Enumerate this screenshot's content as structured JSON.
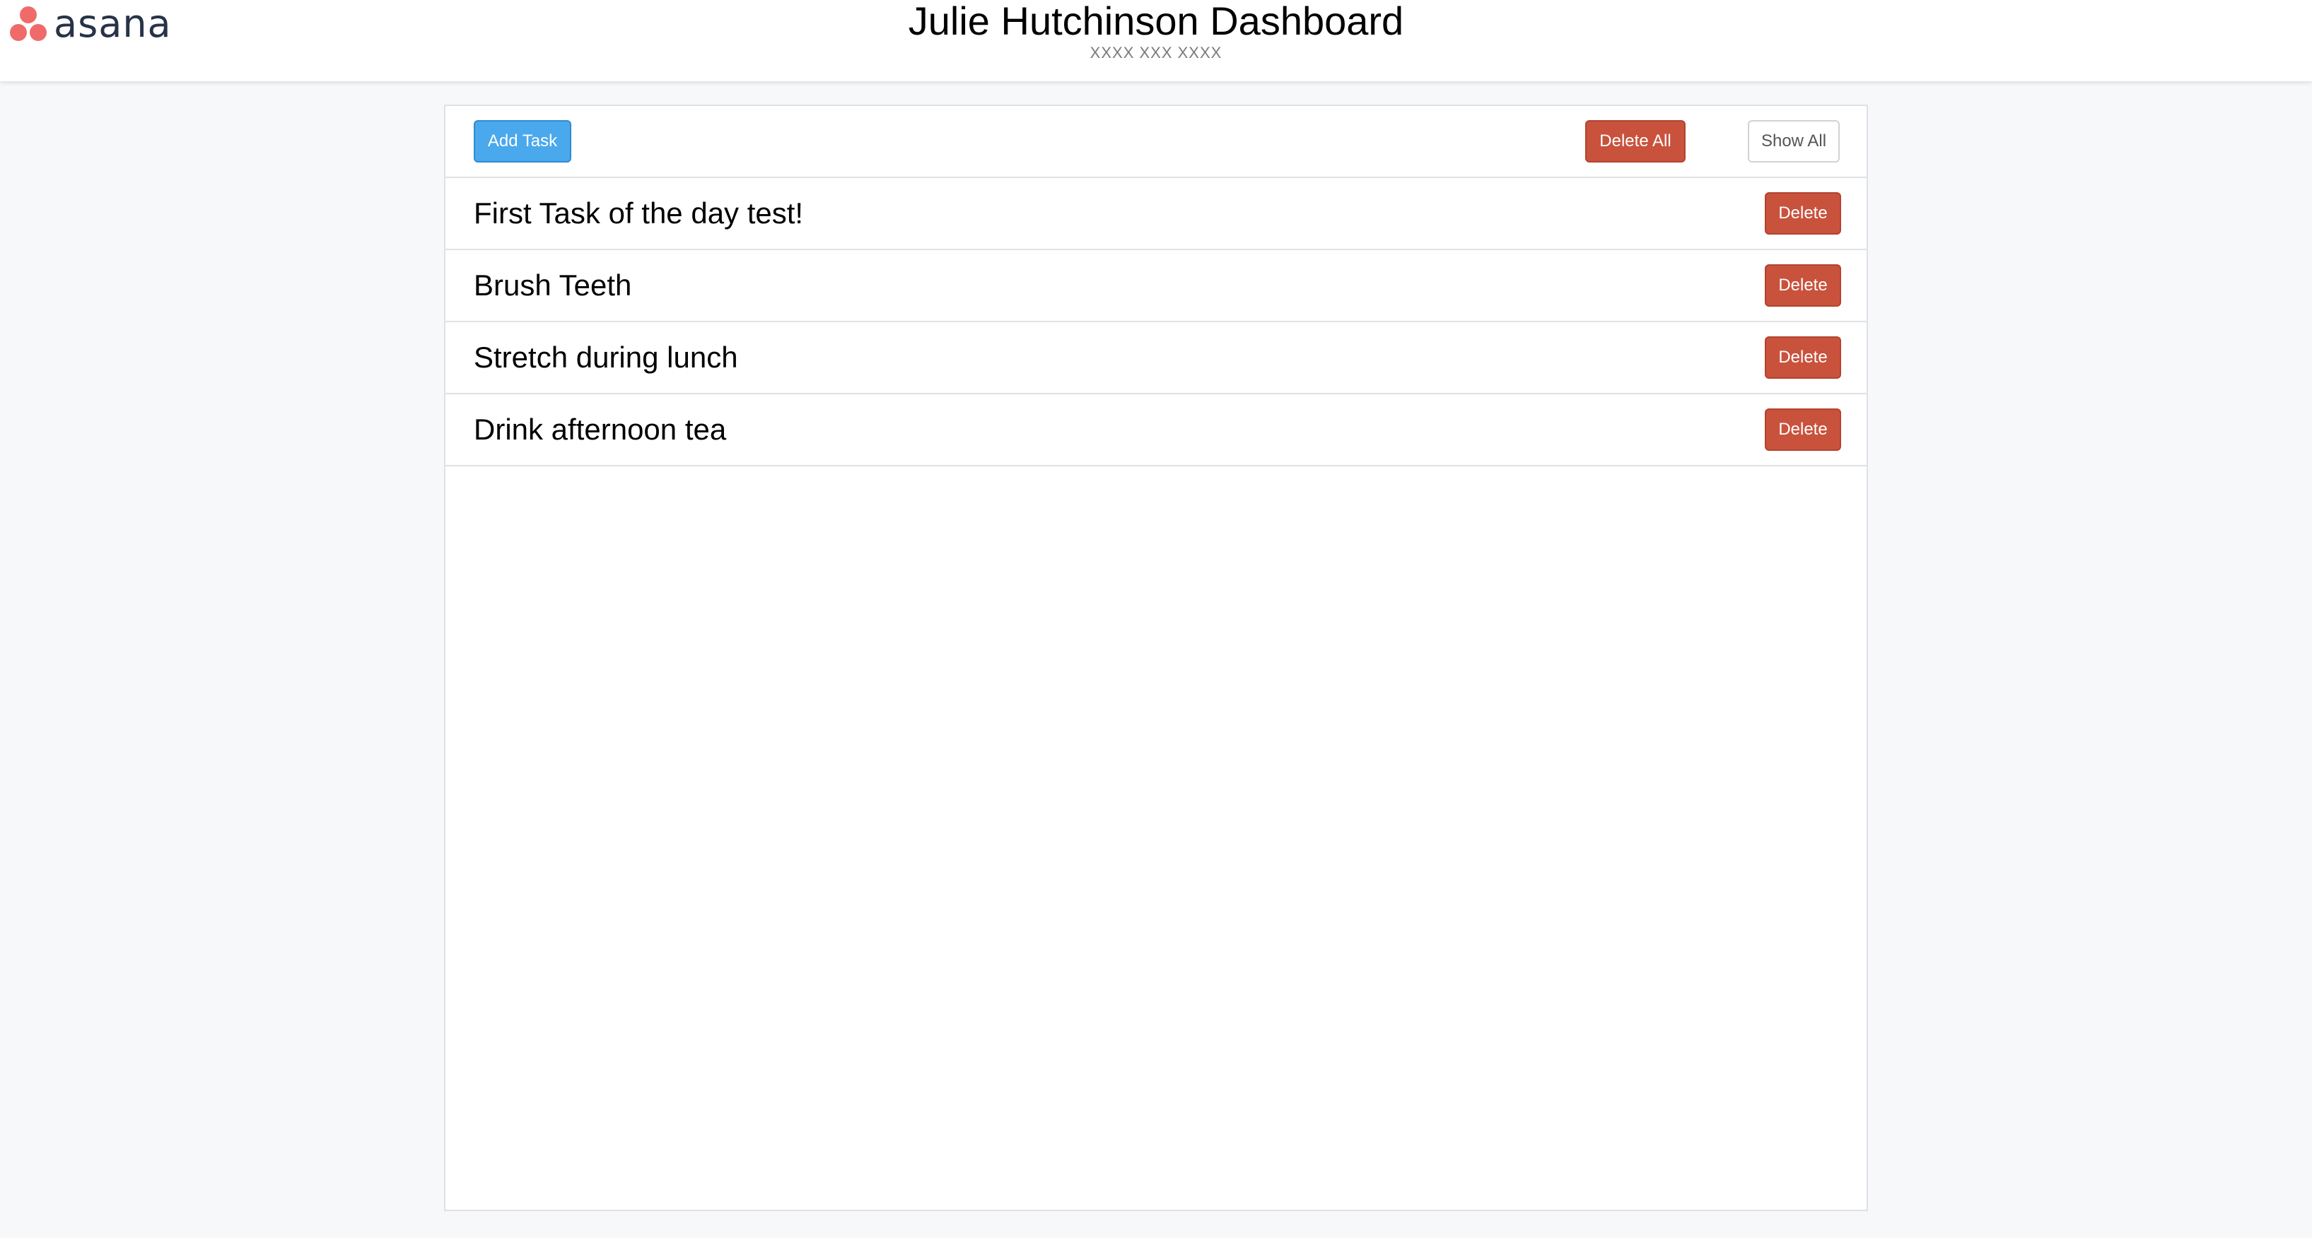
{
  "app": {
    "brand": "asana"
  },
  "header": {
    "title": "Julie Hutchinson Dashboard",
    "subtitle": "XXXX XXX XXXX"
  },
  "toolbar": {
    "add_label": "Add Task",
    "delete_all_label": "Delete All",
    "show_all_label": "Show All"
  },
  "tasks": [
    {
      "text": "First Task of the day test!",
      "delete_label": "Delete"
    },
    {
      "text": "Brush Teeth",
      "delete_label": "Delete"
    },
    {
      "text": "Stretch during lunch",
      "delete_label": "Delete"
    },
    {
      "text": "Drink afternoon tea",
      "delete_label": "Delete"
    }
  ],
  "colors": {
    "primary": "#4aa8ec",
    "danger": "#c9523d",
    "brand_dot": "#f06a6a",
    "brand_text": "#273347"
  }
}
